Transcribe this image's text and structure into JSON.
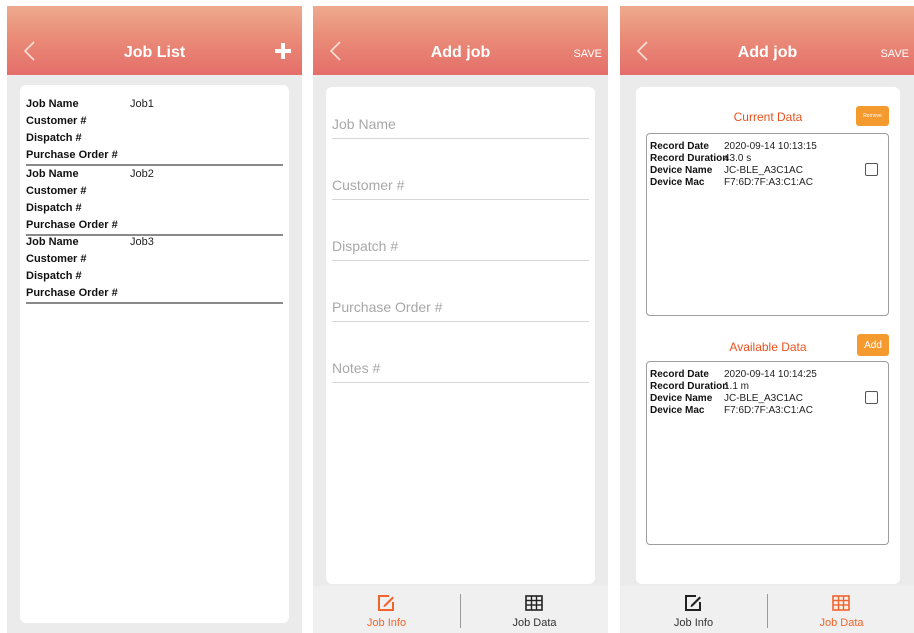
{
  "job_list": {
    "title": "Job List",
    "field_labels": [
      "Job Name",
      "Customer #",
      "Dispatch #",
      "Purchase Order #"
    ],
    "jobs": [
      {
        "name": "Job1",
        "customer": "",
        "dispatch": "",
        "purchase_order": ""
      },
      {
        "name": "Job2",
        "customer": "",
        "dispatch": "",
        "purchase_order": ""
      },
      {
        "name": "Job3",
        "customer": "",
        "dispatch": "",
        "purchase_order": ""
      }
    ]
  },
  "add_job": {
    "title": "Add job",
    "save_label": "SAVE",
    "fields": {
      "job_name": {
        "placeholder": "Job Name",
        "value": ""
      },
      "customer": {
        "placeholder": "Customer #",
        "value": ""
      },
      "dispatch": {
        "placeholder": "Dispatch #",
        "value": ""
      },
      "purchase_order": {
        "placeholder": "Purchase Order #",
        "value": ""
      },
      "notes": {
        "placeholder": "Notes #",
        "value": ""
      }
    }
  },
  "job_data": {
    "title": "Add job",
    "save_label": "SAVE",
    "current": {
      "title": "Current Data",
      "button": "Remove",
      "labels": [
        "Record Date",
        "Record Duration",
        "Device Name",
        "Device Mac"
      ],
      "record": {
        "date": "2020-09-14 10:13:15",
        "duration": "43.0 s",
        "device_name": "JC-BLE_A3C1AC",
        "device_mac": "F7:6D:7F:A3:C1:AC"
      },
      "checked": false
    },
    "available": {
      "title": "Available Data",
      "button": "Add",
      "labels": [
        "Record Date",
        "Record Duration",
        "Device Name",
        "Device Mac"
      ],
      "record": {
        "date": "2020-09-14 10:14:25",
        "duration": "1.1 m",
        "device_name": "JC-BLE_A3C1AC",
        "device_mac": "F7:6D:7F:A3:C1:AC"
      },
      "checked": false
    }
  },
  "bottom_nav": {
    "tabs": [
      {
        "label": "Job Info",
        "icon": "edit-icon"
      },
      {
        "label": "Job Data",
        "icon": "table-icon"
      }
    ]
  },
  "colors": {
    "header_top": "#eeaa8e",
    "header_bottom": "#e46e6a",
    "accent": "#f2642c",
    "button": "#f59a2f"
  }
}
